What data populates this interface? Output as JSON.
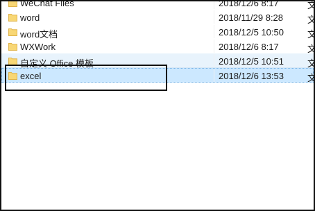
{
  "files": [
    {
      "name": "WeChat Files",
      "date": "2018/12/6 8:17",
      "type": "文",
      "icon": "folder-icon",
      "state": "normal"
    },
    {
      "name": "word",
      "date": "2018/11/29 8:28",
      "type": "文",
      "icon": "folder-icon",
      "state": "normal"
    },
    {
      "name": "word文档",
      "date": "2018/12/5 10:50",
      "type": "文",
      "icon": "folder-icon",
      "state": "normal"
    },
    {
      "name": "WXWork",
      "date": "2018/12/6 8:17",
      "type": "文",
      "icon": "folder-icon",
      "state": "normal"
    },
    {
      "name": "自定义 Office 模板",
      "date": "2018/12/5 10:51",
      "type": "文",
      "icon": "folder-icon",
      "state": "hovered"
    },
    {
      "name": "excel",
      "date": "2018/12/6 13:53",
      "type": "文",
      "icon": "folder-icon",
      "state": "selected"
    }
  ],
  "colors": {
    "selected_bg": "#cce8ff",
    "hover_bg": "#e8f3fc",
    "folder_yellow": "#f8d775",
    "folder_dark": "#e0b34a",
    "annotation": "#111111"
  }
}
